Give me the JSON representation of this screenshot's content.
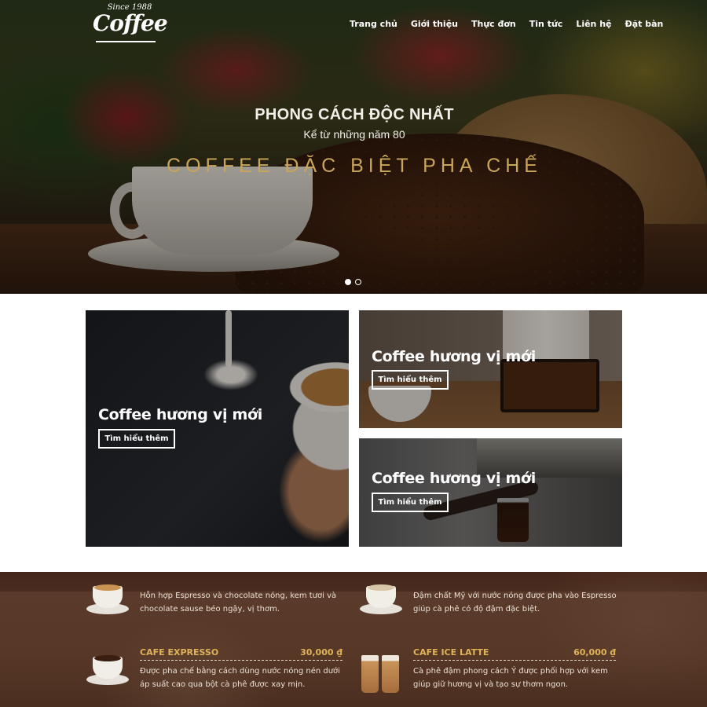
{
  "brand": {
    "since": "Since 1988",
    "name": "Coffee"
  },
  "nav": {
    "items": [
      {
        "label": "Trang chủ"
      },
      {
        "label": "Giới thiệu"
      },
      {
        "label": "Thực đơn"
      },
      {
        "label": "Tin tức"
      },
      {
        "label": "Liên hệ"
      },
      {
        "label": "Đặt bàn"
      }
    ]
  },
  "hero": {
    "title": "PHONG CÁCH ĐỘC NHẤT",
    "subtitle": "Kể từ những năm 80",
    "tagline": "COFFEE ĐẶC BIỆT PHA CHẾ",
    "slides": {
      "count": 2,
      "active": 1
    }
  },
  "features": [
    {
      "title": "Coffee hương vị mới",
      "button": "Tìm hiểu thêm"
    },
    {
      "title": "Coffee hương vị mới",
      "button": "Tìm hiểu thêm"
    },
    {
      "title": "Coffee hương vị mới",
      "button": "Tìm hiểu thêm"
    }
  ],
  "menu": {
    "items": [
      {
        "name": "",
        "price": "",
        "description": "Hỗn hợp Espresso và chocolate nóng, kem tươi và chocolate sause béo ngậy, vị thơm."
      },
      {
        "name": "",
        "price": "",
        "description": "Đậm chất Mỹ với nước nóng được pha vào Espresso giúp cà phê có độ đậm đặc biệt."
      },
      {
        "name": "CAFE EXPRESSO",
        "price": "30,000 ₫",
        "description": "Được pha chế bằng cách dùng nước nóng nén dưới áp suất cao qua bột cà phê được xay mịn."
      },
      {
        "name": "CAFE ICE LATTE",
        "price": "60,000 ₫",
        "description": "Cà phê đậm phong cách Ý được phối hợp với kem giúp giữ hương vị và tạo sự thơm ngon."
      }
    ]
  },
  "colors": {
    "accent_gold": "#e0b35b",
    "tagline_gold": "#c9a55a",
    "menu_bg": "#573827"
  }
}
